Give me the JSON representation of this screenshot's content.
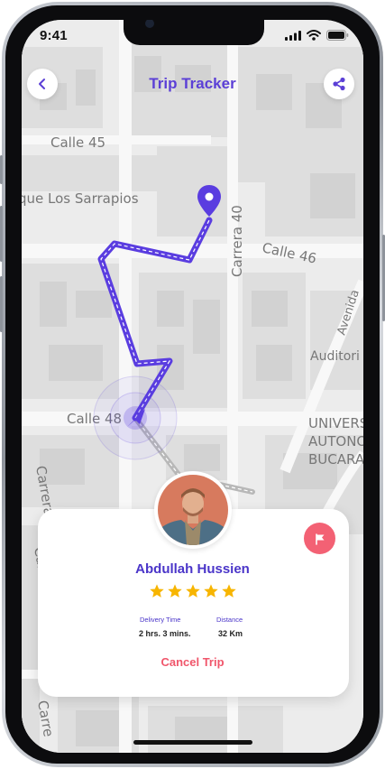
{
  "status_bar": {
    "time": "9:41"
  },
  "header": {
    "title": "Trip Tracker",
    "back_icon": "chevron-left-icon",
    "share_icon": "share-icon"
  },
  "map": {
    "street_labels": [
      "Calle 45",
      "que Los Sarrapios",
      "Carrera 40",
      "Calle 46",
      "Avenida",
      "Auditori",
      "Calle 48",
      "UNIVERS",
      "AUTONO",
      "BUCARAI",
      "Carrera",
      "Carre",
      "Carre"
    ],
    "route_color": "#5a3de0",
    "destination_pin_icon": "location-pin-icon",
    "driver_icon": "navigation-arrow-icon"
  },
  "driver": {
    "name": "Abdullah Hussien",
    "rating": 5,
    "rating_icon": "star-icon",
    "delivery_time_label": "Delivery Time",
    "delivery_time": "2 hrs. 3 mins.",
    "distance_label": "Distance",
    "distance": "32 Km",
    "flag_icon": "flag-icon"
  },
  "actions": {
    "cancel_label": "Cancel Trip"
  },
  "colors": {
    "accent": "#5b3fd6",
    "danger": "#f36174",
    "star": "#f7b500"
  }
}
